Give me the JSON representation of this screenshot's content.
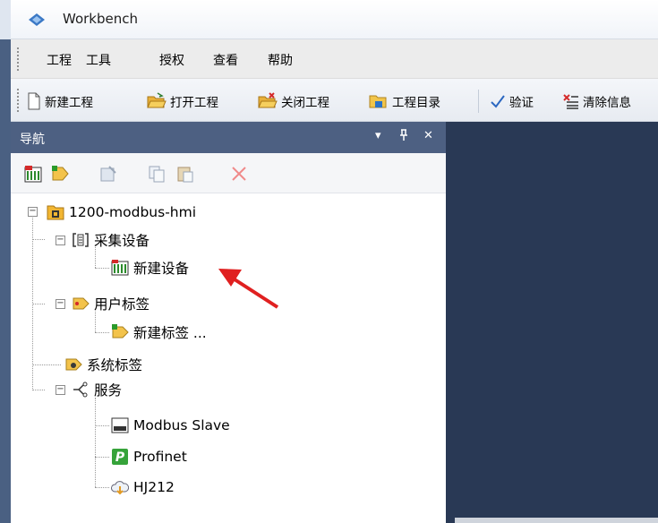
{
  "window": {
    "title": "Workbench"
  },
  "menu": {
    "items": [
      "工程",
      "工具",
      "授权",
      "查看",
      "帮助"
    ]
  },
  "toolbar": {
    "new_project": "新建工程",
    "open_project": "打开工程",
    "close_project": "关闭工程",
    "project_dir": "工程目录",
    "verify": "验证",
    "clear_info": "清除信息"
  },
  "nav": {
    "title": "导航",
    "controls": {
      "dropdown": "▾",
      "pin": "ᵖ",
      "close": "✕"
    },
    "tree": {
      "project": "1200-modbus-hmi",
      "acquisition": "采集设备",
      "new_device": "新建设备",
      "user_tags": "用户标签",
      "new_tag": "新建标签 ...",
      "system_tags": "系统标签",
      "services": "服务",
      "modbus_slave": "Modbus Slave",
      "profinet": "Profinet",
      "hj212": "HJ212"
    }
  },
  "colors": {
    "nav_header": "#4d6082",
    "workspace": "#293955",
    "arrow": "#e02020"
  }
}
